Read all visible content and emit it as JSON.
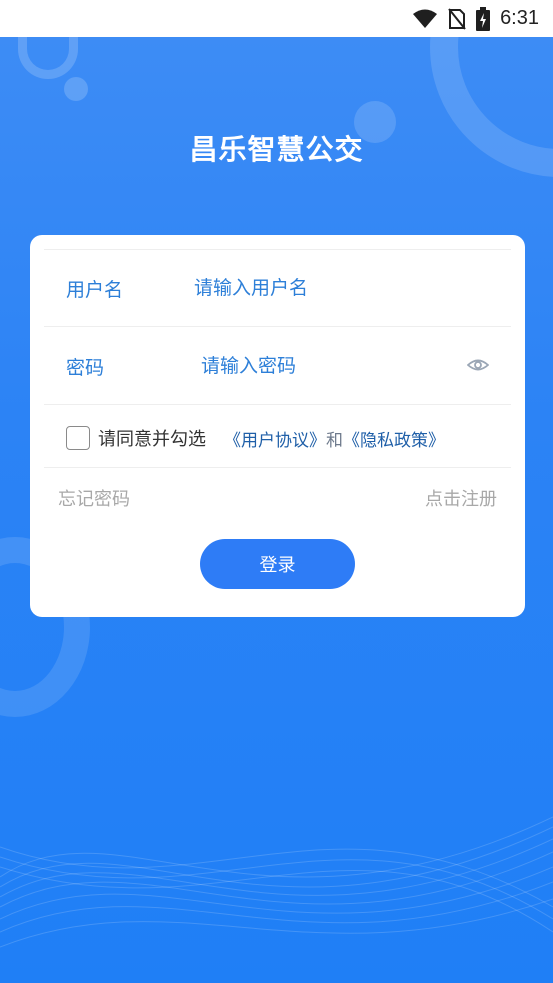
{
  "status_bar": {
    "time": "6:31",
    "icons": [
      "wifi-icon",
      "no-sim-icon",
      "battery-charging-icon"
    ]
  },
  "app": {
    "title": "昌乐智慧公交"
  },
  "login_form": {
    "username_label": "用户名",
    "username_placeholder": "请输入用户名",
    "password_label": "密码",
    "password_placeholder": "请输入密码",
    "password_toggle_icon": "eye-icon",
    "agree_text": "请同意并勾选",
    "user_agreement": "《用户协议》",
    "and_text": "和",
    "privacy_policy": "《隐私政策》",
    "forgot_password": "忘记密码",
    "register": "点击注册",
    "login_button": "登录"
  },
  "colors": {
    "background_top": "#3d8cf5",
    "background_bottom": "#1f7ff6",
    "accent_text": "#2d7fd8",
    "link": "#1f5fa8",
    "button": "#2e7cf6",
    "muted_text": "#a8a8a8"
  }
}
